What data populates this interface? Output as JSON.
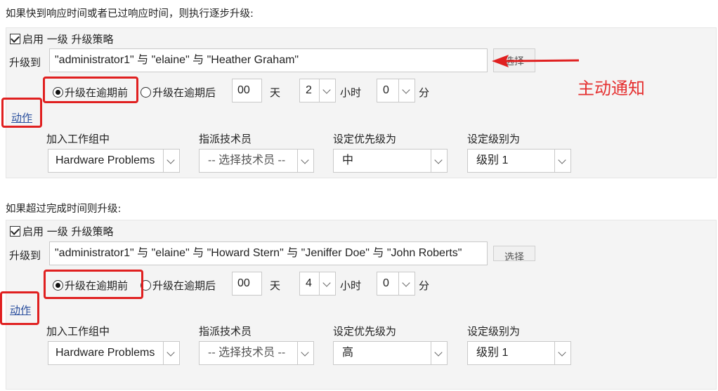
{
  "section1": {
    "heading": "如果快到响应时间或者已过响应时间，则执行逐步升级:",
    "enable_label": "启用 一级 升级策略",
    "escalate_to_label": "升级到",
    "escalate_to_value": "\"administrator1\" 与 \"elaine\" 与 \"Heather Graham\"",
    "select_button": "选择",
    "radio_before": "升级在逾期前",
    "radio_after": "升级在逾期后",
    "radio_selected": "before",
    "days_value": "00",
    "days_unit": "天",
    "hours_value": "2",
    "hours_unit": "小时",
    "minutes_value": "0",
    "minutes_unit": "分",
    "action_link": "动作",
    "group_label": "加入工作组中",
    "group_value": "Hardware Problems",
    "tech_label": "指派技术员",
    "tech_value": "-- 选择技术员 --",
    "priority_label": "设定优先级为",
    "priority_value": "中",
    "level_label": "设定级别为",
    "level_value": "级别 1"
  },
  "section2": {
    "heading": "如果超过完成时间则升级:",
    "enable_label": "启用 一级 升级策略",
    "escalate_to_label": "升级到",
    "escalate_to_value": "\"administrator1\" 与 \"elaine\" 与 \"Howard Stern\" 与 \"Jeniffer Doe\" 与 \"John Roberts\"",
    "select_button": "选择",
    "radio_before": "升级在逾期前",
    "radio_after": "升级在逾期后",
    "radio_selected": "before",
    "days_value": "00",
    "days_unit": "天",
    "hours_value": "4",
    "hours_unit": "小时",
    "minutes_value": "0",
    "minutes_unit": "分",
    "action_link": "动作",
    "group_label": "加入工作组中",
    "group_value": "Hardware Problems",
    "tech_label": "指派技术员",
    "tech_value": "-- 选择技术员 --",
    "priority_label": "设定优先级为",
    "priority_value": "高",
    "level_label": "设定级别为",
    "level_value": "级别 1"
  },
  "annotation": {
    "callout_text": "主动通知",
    "color": "#e02020"
  },
  "icons": [
    "checkbox-checked-icon",
    "radio-selected-icon",
    "radio-unselected-icon",
    "chevron-down-icon",
    "red-arrow-icon"
  ]
}
